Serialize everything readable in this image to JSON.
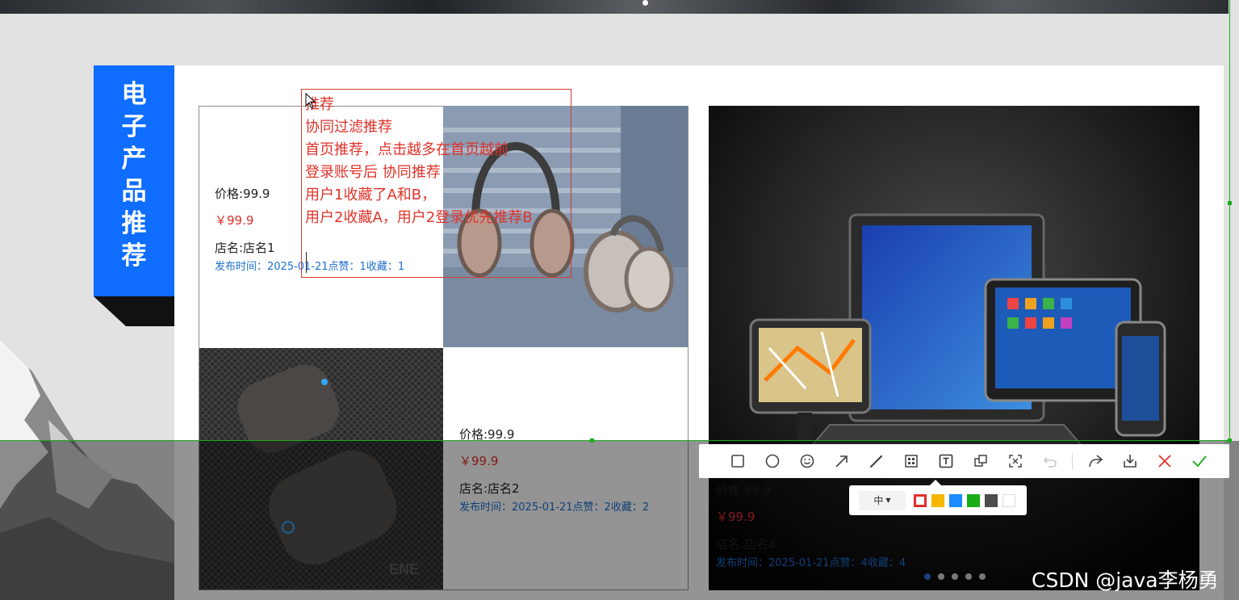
{
  "section": {
    "title_chars": [
      "电",
      "子",
      "产",
      "品",
      "推",
      "荐"
    ],
    "accent_color": "#0f6dff"
  },
  "products": [
    {
      "price_label": "价格:99.9",
      "price": "￥99.9",
      "shop": "店名:店名1",
      "meta": "发布时间：2025-01-21点赞：1收藏：1"
    },
    {
      "price_label": "价格:99.9",
      "price": "￥99.9",
      "shop": "店名:店名2",
      "meta": "发布时间：2025-01-21点赞：2收藏：2"
    },
    {
      "price_label": "价格:99.9",
      "price": "￥99.9",
      "shop": "店名:店名4",
      "meta": "发布时间：2025-01-21点赞：4收藏：4"
    }
  ],
  "annotation": {
    "lines": [
      "推荐",
      "协同过滤推荐",
      "首页推荐，点击越多在首页越前",
      "登录账号后      协同推荐",
      "用户1收藏了A和B，",
      "用户2收藏A，用户2登录优先推荐B"
    ],
    "color": "#e0332a"
  },
  "toolbar": {
    "tools": [
      "rectangle-icon",
      "ellipse-icon",
      "emoji-icon",
      "arrow-icon",
      "pen-icon",
      "mosaic-icon",
      "text-icon",
      "pin-icon",
      "ocr-icon",
      "undo-icon",
      "share-icon",
      "download-icon",
      "close-icon",
      "confirm-icon"
    ],
    "size_label": "中",
    "colors": [
      "#e0302b",
      "#f5b700",
      "#1a8cff",
      "#1aad19",
      "#4d4d4d",
      "#ffffff"
    ],
    "selection_color": "#1aad19"
  },
  "carousel": {
    "count": 5,
    "active": 0
  },
  "watermark": "CSDN @java李杨勇"
}
